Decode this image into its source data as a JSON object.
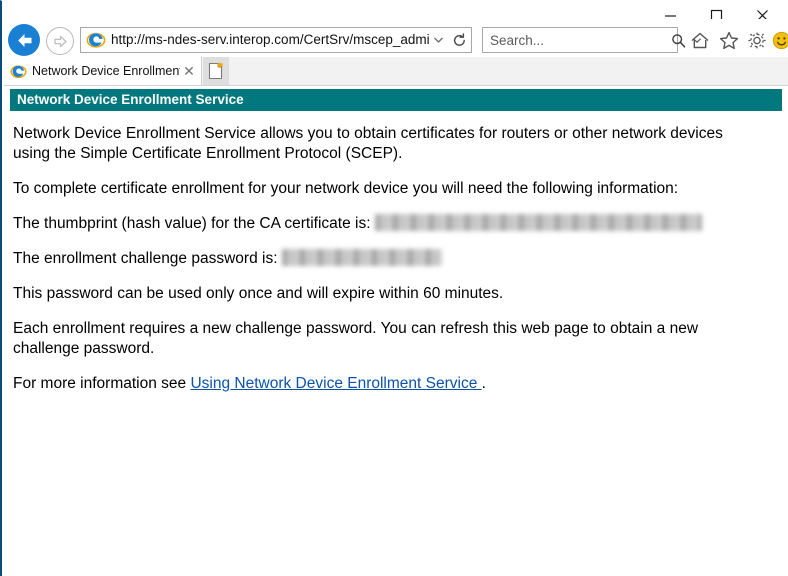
{
  "browser": {
    "window_controls": {
      "minimize_label": "Minimize",
      "maximize_label": "Maximize",
      "close_label": "Close"
    },
    "navigation": {
      "back_label": "Back",
      "forward_label": "Forward",
      "refresh_label": "Refresh",
      "address_dropdown_label": "Address history"
    },
    "address": {
      "url": "http://ms-ndes-serv.interop.com/CertSrv/mscep_admin/",
      "favicon": "internet-explorer-icon"
    },
    "search": {
      "placeholder": "Search...",
      "value": "",
      "icon": "search-icon",
      "dropdown": "chevron-down-icon"
    },
    "command_bar": [
      {
        "name": "home-button",
        "icon": "home-icon",
        "label": "Home"
      },
      {
        "name": "favorites-button",
        "icon": "star-icon",
        "label": "Favorites"
      },
      {
        "name": "tools-button",
        "icon": "gear-icon",
        "label": "Tools"
      },
      {
        "name": "feedback-button",
        "icon": "smiley-icon",
        "label": "Send feedback"
      }
    ],
    "tabs": [
      {
        "title": "Network Device Enrollment...",
        "favicon": "internet-explorer-icon",
        "close_label": "✕",
        "active": true
      }
    ],
    "new_tab": {
      "label": "New tab",
      "icon": "new-tab-page-icon"
    }
  },
  "page": {
    "banner_title": "Network Device Enrollment Service",
    "banner_color": "#00787d",
    "paragraphs": {
      "intro": "Network Device Enrollment Service allows you to obtain certificates for routers or other network devices using the Simple Certificate Enrollment Protocol (SCEP).",
      "requirements": "To complete certificate enrollment for your network device you will need the following information:",
      "thumbprint_label": "The thumbprint (hash value) for the CA certificate is:",
      "thumbprint_value": "",
      "password_label": "The enrollment challenge password is:",
      "password_value": "",
      "expiry_note": "This password can be used only once and will expire within 60 minutes.",
      "refresh_note": "Each enrollment requires a new challenge password. You can refresh this web page to obtain a new challenge password.",
      "more_info_prefix": "For more information see ",
      "more_info_link": "Using Network Device Enrollment Service ",
      "more_info_suffix": "."
    },
    "link_color": "#0b52a8"
  }
}
